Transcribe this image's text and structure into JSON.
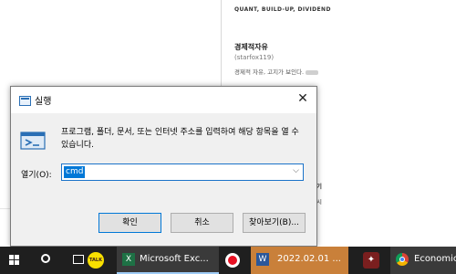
{
  "background": {
    "tagline": "QUANT, BUILD-UP, DIVIDEND",
    "blog_title": "경제적자유",
    "blog_id": "(starfox119)",
    "blog_desc": "경제적 자유, 고지가 보인다.",
    "side_text_a": "기",
    "side_text_b": "시"
  },
  "dialog": {
    "title": "실행",
    "instruction": "프로그램, 폴더, 문서, 또는 인터넷 주소를 입력하여 해당 항목을 열 수 있습니다.",
    "open_label": "열기(O):",
    "command_value": "cmd",
    "ok_label": "확인",
    "cancel_label": "취소",
    "browse_label": "찾아보기(B)...",
    "accent_color": "#0078d7"
  },
  "taskbar": {
    "kakao_label": "TALK",
    "excel_label": "Microsoft Exc...",
    "word_label": "2022.02.01 ...",
    "chrome_label": "Economic",
    "icons": [
      "windows-start-icon",
      "search-icon",
      "task-view-icon",
      "kakaotalk-icon",
      "excel-icon",
      "record-icon",
      "word-icon",
      "app-icon",
      "chrome-icon"
    ]
  }
}
